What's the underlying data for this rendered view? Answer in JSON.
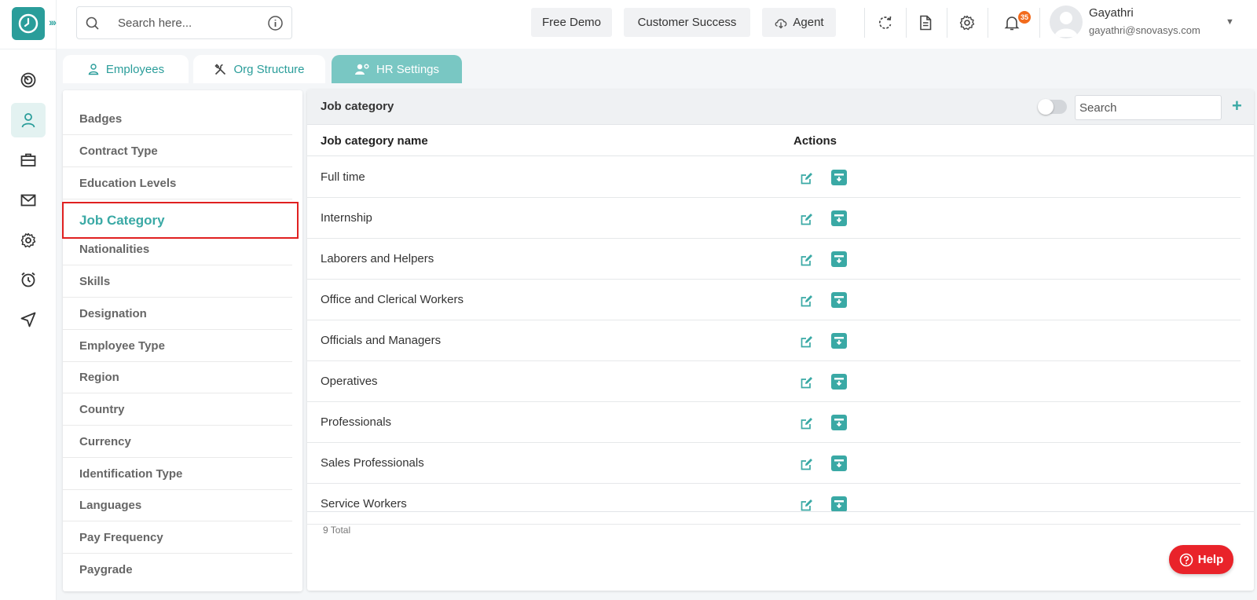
{
  "topbar": {
    "search_placeholder": "Search here...",
    "free_demo": "Free Demo",
    "customer_success": "Customer Success",
    "agent": "Agent",
    "notification_count": "35",
    "user_name": "Gayathri",
    "user_email": "gayathri@snovasys.com"
  },
  "tabs": [
    {
      "label": "Employees",
      "icon": "user-icon"
    },
    {
      "label": "Org Structure",
      "icon": "tools-icon"
    },
    {
      "label": "HR Settings",
      "icon": "users-gear-icon",
      "active": true
    }
  ],
  "menu": [
    {
      "label": "Badges"
    },
    {
      "label": "Contract Type"
    },
    {
      "label": "Education Levels"
    },
    {
      "label": "Job Category",
      "active": true
    },
    {
      "label": "Nationalities"
    },
    {
      "label": "Skills"
    },
    {
      "label": "Designation"
    },
    {
      "label": "Employee Type"
    },
    {
      "label": "Region"
    },
    {
      "label": "Country"
    },
    {
      "label": "Currency"
    },
    {
      "label": "Identification Type"
    },
    {
      "label": "Languages"
    },
    {
      "label": "Pay Frequency"
    },
    {
      "label": "Paygrade"
    }
  ],
  "panel": {
    "title": "Job category",
    "search_placeholder": "Search",
    "col_name": "Job category name",
    "col_actions": "Actions",
    "rows": [
      "Full time",
      "Internship",
      "Laborers and Helpers",
      "Office and Clerical Workers",
      "Officials and Managers",
      "Operatives",
      "Professionals",
      "Sales Professionals",
      "Service Workers"
    ],
    "total": "9 Total"
  },
  "help_label": "Help",
  "colors": {
    "accent": "#3aa9a5",
    "help": "#e9232a",
    "highlight": "#e02020"
  }
}
